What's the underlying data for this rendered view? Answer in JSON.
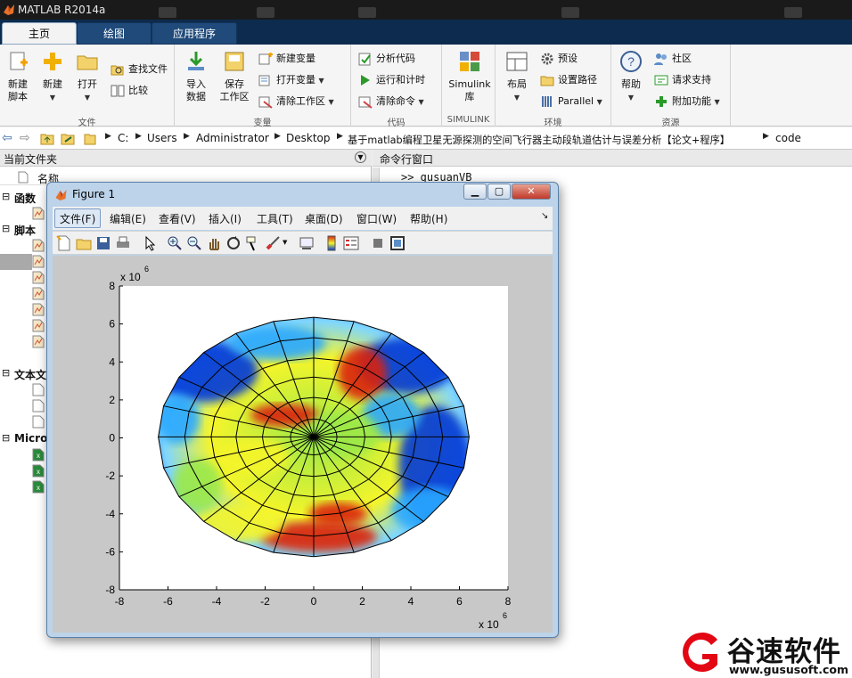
{
  "app": {
    "title": "MATLAB R2014a"
  },
  "tabs": [
    {
      "label": "主页",
      "active": true
    },
    {
      "label": "绘图",
      "active": false
    },
    {
      "label": "应用程序",
      "active": false
    }
  ],
  "ribbon": {
    "file": {
      "label": "文件",
      "new_script": "新建\n脚本",
      "new": "新建",
      "open": "打开",
      "find_files": "查找文件",
      "compare": "比较"
    },
    "variable": {
      "label": "变量",
      "import": "导入\n数据",
      "save_ws": "保存\n工作区",
      "new_var": "新建变量",
      "open_var": "打开变量",
      "clear_ws": "清除工作区"
    },
    "code": {
      "label": "代码",
      "analyze": "分析代码",
      "run_time": "运行和计时",
      "clear_cmd": "清除命令"
    },
    "simulink": {
      "label": "SIMULINK",
      "lib": "Simulink\n库"
    },
    "env": {
      "label": "环境",
      "layout": "布局",
      "prefs": "预设",
      "set_path": "设置路径",
      "parallel": "Parallel"
    },
    "resources": {
      "label": "资源",
      "help": "帮助",
      "community": "社区",
      "support": "请求支持",
      "addons": "附加功能"
    }
  },
  "address": {
    "crumbs": [
      "C:",
      "Users",
      "Administrator",
      "Desktop",
      "基于matlab编程卫星无源探测的空间飞行器主动段轨道估计与误差分析【论文+程序】",
      "code"
    ]
  },
  "current_folder": {
    "header": "当前文件夹",
    "name_col": "名称",
    "groups": [
      "函数",
      "脚本",
      "文本文",
      "Micro"
    ]
  },
  "command_window": {
    "header": "命令行窗口",
    "line1": ">> gusuanVB"
  },
  "figure": {
    "title": "Figure 1",
    "menu": [
      "文件(F)",
      "编辑(E)",
      "查看(V)",
      "插入(I)",
      "工具(T)",
      "桌面(D)",
      "窗口(W)",
      "帮助(H)"
    ],
    "exponent_y": "x 10",
    "exponent_y_power": "6",
    "exponent_x": "x 10",
    "exponent_x_power": "6"
  },
  "chart_data": {
    "type": "heatmap",
    "subtype": "polar surface view",
    "xlim": [
      -8,
      8
    ],
    "ylim": [
      -8,
      8
    ],
    "xticks": [
      "-8",
      "-6",
      "-4",
      "-2",
      "0",
      "2",
      "4",
      "6",
      "8"
    ],
    "yticks": [
      "8",
      "6",
      "4",
      "2",
      "0",
      "-2",
      "-4",
      "-6",
      "-8"
    ],
    "grid": "polar mesh",
    "colors": {
      "low": "#0038d8",
      "mid_low": "#2aa8ff",
      "mid": "#9be84a",
      "mid_high": "#f5f52a",
      "high": "#d92010"
    }
  },
  "watermark": {
    "brand": "谷速软件",
    "url": "www.gususoft.com"
  }
}
